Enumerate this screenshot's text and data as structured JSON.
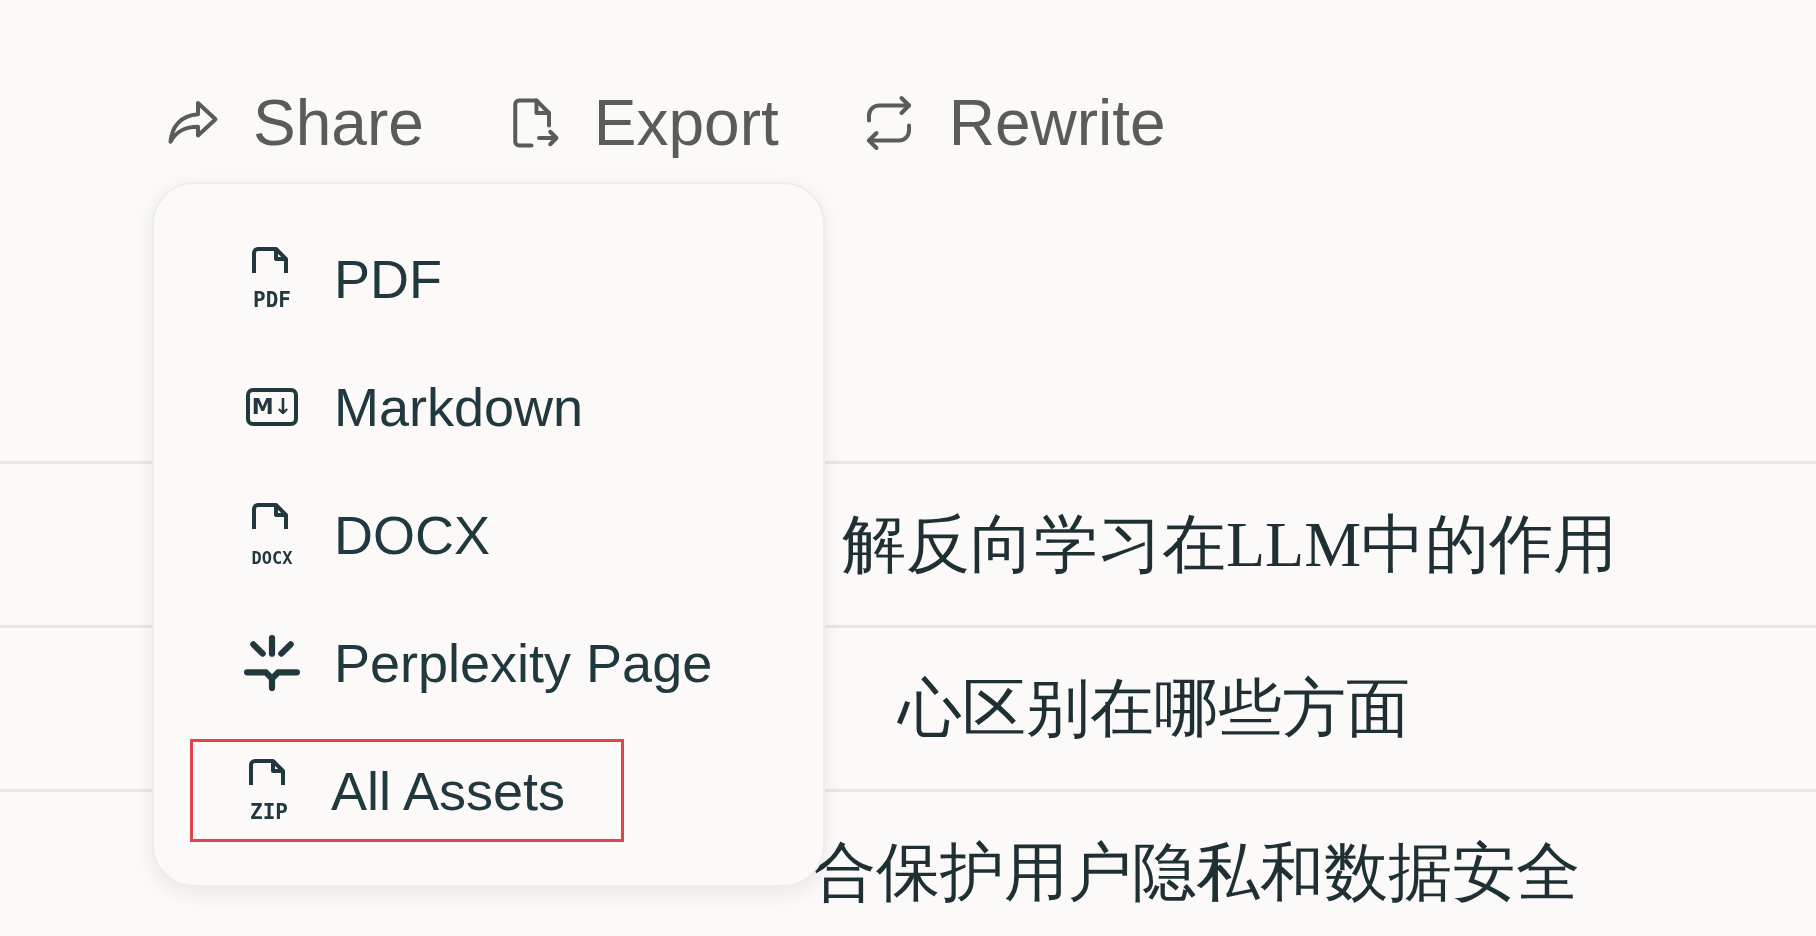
{
  "toolbar": [
    {
      "kind": "share",
      "label": "Share"
    },
    {
      "kind": "export",
      "label": "Export"
    },
    {
      "kind": "rewrite",
      "label": "Rewrite"
    }
  ],
  "rows": [
    {
      "text": "解反向学习在LLM中的作用"
    },
    {
      "text": "心区别在哪些方面"
    },
    {
      "text": "合保护用户隐私和数据安全"
    }
  ],
  "export_menu": {
    "items": [
      {
        "kind": "file",
        "icon_label": "PDF",
        "label": "PDF",
        "outlined": false
      },
      {
        "kind": "markdown",
        "icon_label": "M↓",
        "label": "Markdown",
        "outlined": false
      },
      {
        "kind": "file",
        "icon_label": "DOCX",
        "label": "DOCX",
        "outlined": false
      },
      {
        "kind": "perplexity",
        "label": "Perplexity Page",
        "outlined": false
      },
      {
        "kind": "file",
        "icon_label": "ZIP",
        "label": "All Assets",
        "outlined": true
      }
    ]
  }
}
